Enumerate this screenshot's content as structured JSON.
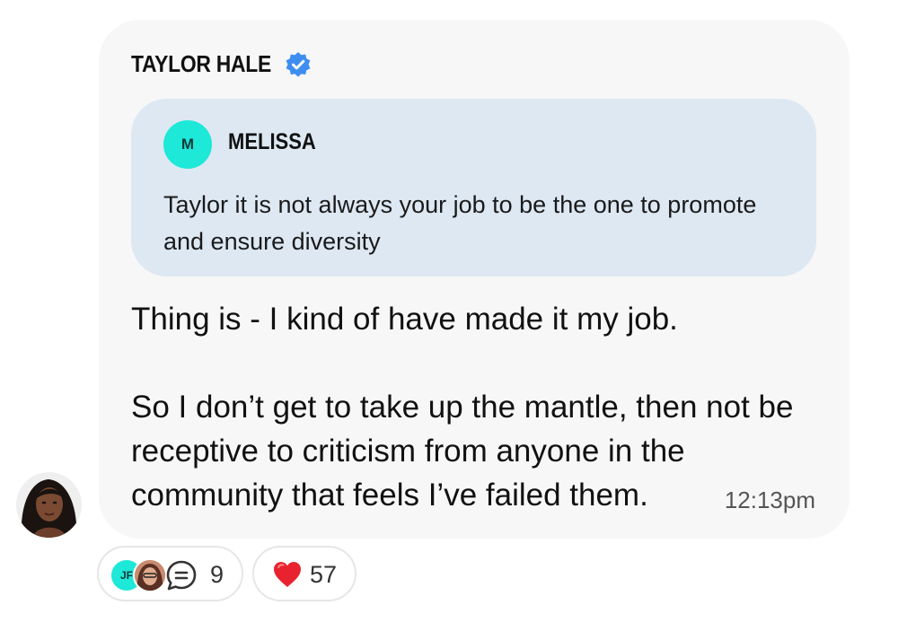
{
  "post": {
    "author": "TAYLOR HALE",
    "author_verified": true,
    "time": "12:13pm",
    "message": "Thing is - I kind of have made it my job.\n\nSo I don’t get to take up the mantle, then not be receptive to criticism from anyone in the community that feels I’ve failed them."
  },
  "quote": {
    "avatar_initial": "M",
    "name": "MELISSA",
    "text": "Taylor it is not always your job to be the one to promote and ensure diversity"
  },
  "reactions": {
    "reply_avatar_initials": "JF",
    "reply_count": "9",
    "heart_count": "57"
  },
  "colors": {
    "bubble": "#f7f7f7",
    "quote_bg": "#dde8f3",
    "avatar_teal": "#1ee8d8",
    "verified_blue": "#3d8ef0",
    "heart_red": "#e8232f"
  }
}
